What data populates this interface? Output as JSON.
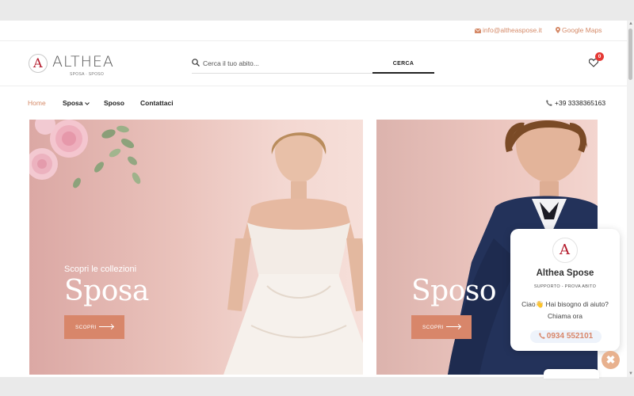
{
  "topbar": {
    "email": "info@altheaspose.it",
    "maps": "Google Maps"
  },
  "brand": {
    "mark": "A",
    "name": "ALTHEA",
    "tagline": "SPOSA · SPOSO"
  },
  "search": {
    "placeholder": "Cerca il tuo abito...",
    "button": "CERCA"
  },
  "cart": {
    "count": "0",
    "icon": "heart-icon"
  },
  "nav": {
    "items": [
      {
        "label": "Home",
        "active": true
      },
      {
        "label": "Sposa"
      },
      {
        "label": "Sposo"
      },
      {
        "label": "Contattaci"
      }
    ],
    "phone": "+39 3338365163"
  },
  "banners": [
    {
      "kicker": "Scopri le collezioni",
      "title": "Sposa",
      "cta": "SCOPRI"
    },
    {
      "title": "Sposo",
      "cta": "SCOPRI"
    }
  ],
  "chat": {
    "name": "Althea Spose",
    "subtitle": "SUPPORTO - PROVA ABITO",
    "message_line1": "Ciao👋 Hai bisogno di aiuto?",
    "message_line2": "Chiama ora",
    "phone": "0934 552101",
    "close": "✖"
  },
  "colors": {
    "accent": "#d58a68",
    "button": "#d8866a",
    "badge": "#e53935",
    "logo_red": "#b3182a"
  }
}
